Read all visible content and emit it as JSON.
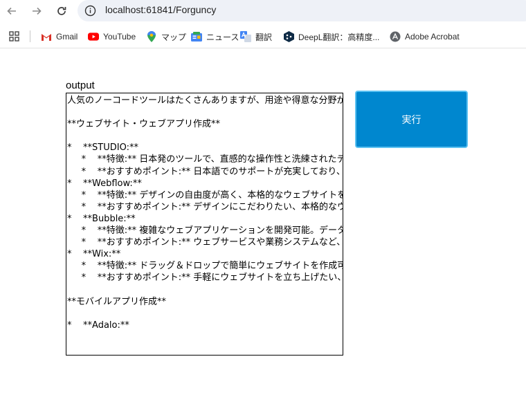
{
  "browser": {
    "url": "localhost:61841/Forguncy",
    "bookmarks": [
      {
        "label": "Gmail",
        "icon": "gmail-icon"
      },
      {
        "label": "YouTube",
        "icon": "youtube-icon"
      },
      {
        "label": "マップ",
        "icon": "maps-icon"
      },
      {
        "label": "ニュース",
        "icon": "news-icon"
      },
      {
        "label": "翻訳",
        "icon": "translate-icon"
      },
      {
        "label": "DeepL翻訳：高精度...",
        "icon": "deepl-icon"
      },
      {
        "label": "Adobe Acrobat",
        "icon": "acrobat-icon"
      }
    ]
  },
  "page": {
    "output_label": "output",
    "output_text": "人気のノーコードツールはたくさんありますが、用途や得意な分野が異なります。\n\n**ウェブサイト・ウェブアプリ作成**\n\n*    **STUDIO:**\n     *    **特徴:** 日本発のツールで、直感的な操作性と洗練されたデザイン\n     *    **おすすめポイント:** 日本語でのサポートが充実しており、初心者\n*    **Webflow:**\n     *    **特徴:** デザインの自由度が高く、本格的なウェブサイトを作成可能\n     *    **おすすめポイント:** デザインにこだわりたい、本格的なウェブサイト\n*    **Bubble:**\n     *    **特徴:** 複雑なウェブアプリケーションを開発可能。データベース\n     *    **おすすめポイント:** ウェブサービスや業務システムなど、高度な\n*    **Wix:**\n     *    **特徴:** ドラッグ＆ドロップで簡単にウェブサイトを作成可能\n     *    **おすすめポイント:** 手軽にウェブサイトを立ち上げたい、デザイン\n\n**モバイルアプリ作成**\n\n*    **Adalo:**",
    "run_button_label": "実行"
  },
  "colors": {
    "run_button": "#0087cf",
    "run_button_border": "#5cc2f2"
  }
}
